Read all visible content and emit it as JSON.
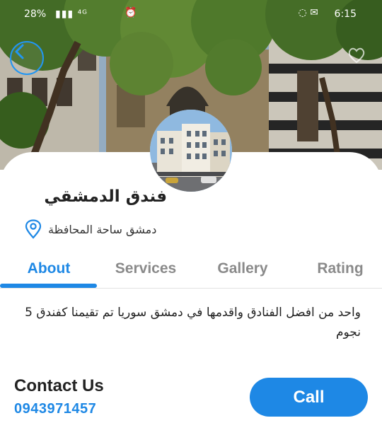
{
  "status_bar": {
    "battery": "28%",
    "signal": "▮▮▮ ⁴ᴳ",
    "alarm_icon": "alarm-icon",
    "time": "6:15",
    "right_icons": "◌ ✉"
  },
  "header": {
    "back_icon": "chevron-left-icon",
    "favorite_icon": "heart-icon"
  },
  "hotel": {
    "name": "فندق الدمشقي",
    "location": "دمشق ساحة المحافظة"
  },
  "tabs": [
    {
      "label": "About",
      "active": true
    },
    {
      "label": "Services",
      "active": false
    },
    {
      "label": "Gallery",
      "active": false
    },
    {
      "label": "Rating",
      "active": false
    }
  ],
  "about": {
    "description": "واحد من افضل الفنادق واقدمها في دمشق سوريا تم تقيمنا كفندق 5 نجوم"
  },
  "contact": {
    "title": "Contact Us",
    "phone": "0943971457",
    "call_label": "Call"
  },
  "colors": {
    "accent": "#1e88e5",
    "inactive_tab": "#8a8a8a"
  }
}
